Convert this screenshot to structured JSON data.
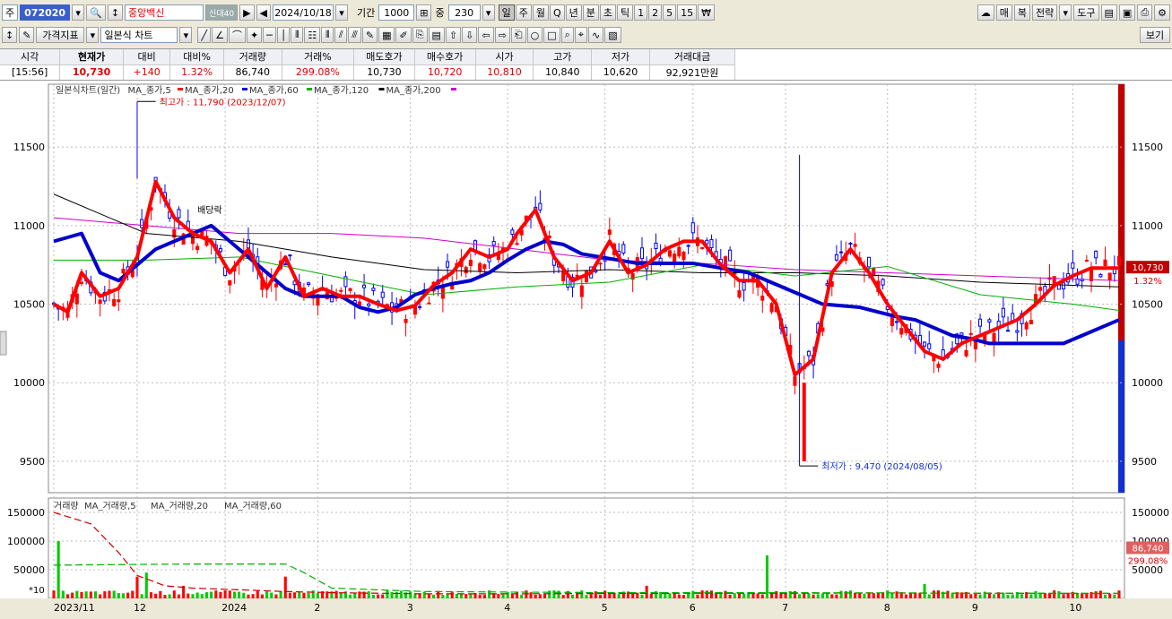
{
  "toolbar1": {
    "prefix": "주",
    "code": "072020",
    "name": "중앙백신",
    "badge": "신대40",
    "date": "2024/10/18",
    "period_label": "기간",
    "period_value": "1000",
    "count_label": "중",
    "count_value": "230",
    "intervals": [
      "일",
      "주",
      "월",
      "Q",
      "년",
      "분",
      "초",
      "틱",
      "1",
      "2",
      "5",
      "15",
      "₩"
    ],
    "right_buttons": [
      "매",
      "복",
      "전략",
      "도구"
    ]
  },
  "toolbar2": {
    "indicator_label": "가격지표",
    "chart_type": "일본식 차트",
    "view_label": "보기"
  },
  "quote": {
    "headers": [
      "시각",
      "현재가",
      "대비",
      "대비%",
      "거래량",
      "거래%",
      "매도호가",
      "매수호가",
      "시가",
      "고가",
      "저가",
      "거래대금"
    ],
    "values": [
      "[15:56]",
      "10,730",
      "+140",
      "1.32%",
      "86,740",
      "299.08%",
      "10,730",
      "10,720",
      "10,810",
      "10,840",
      "10,620",
      "92,921만원"
    ]
  },
  "price_legend": [
    "일본식차트(일간)",
    "MA_종가,5",
    "MA_종가,20",
    "MA_종가,60",
    "MA_종가,120",
    "MA_종가,200"
  ],
  "volume_legend": [
    "거래량",
    "MA_거래량,5",
    "MA_거래량,20",
    "MA_거래량,60"
  ],
  "annotations": {
    "high": "최고가 : 11,790 (2023/12/07)",
    "low": "최저가 : 9,470 (2024/08/05)",
    "dividend": "배당락",
    "volume_unit": "*10"
  },
  "right_labels": {
    "price": "10,730",
    "change": "1.32%",
    "volume": "86,740",
    "volume_pct": "299.08%"
  },
  "colors": {
    "ma5": "#ff0000",
    "ma20": "#0000cc",
    "ma60": "#00b000",
    "ma120": "#000000",
    "ma200": "#cc00cc",
    "up": "#ff0000",
    "down": "#0000ff"
  },
  "chart_data": [
    {
      "type": "line",
      "title": "일본식차트(일간)",
      "ylim": [
        9300,
        11900
      ],
      "y_ticks": [
        9500,
        10000,
        10500,
        11000,
        11500
      ],
      "x_labels": [
        "2023/11",
        "12",
        "2024",
        "2",
        "3",
        "4",
        "5",
        "6",
        "7",
        "8",
        "9",
        "10"
      ],
      "series": [
        {
          "name": "MA_종가,5",
          "x": [
            0,
            3,
            6,
            10,
            14,
            18,
            22,
            26,
            30,
            34,
            38,
            42,
            46,
            50,
            54,
            58,
            62,
            66,
            70,
            74,
            78,
            82,
            86,
            90,
            94,
            98,
            100,
            104,
            108,
            112,
            116,
            120,
            124,
            128,
            132,
            136,
            140,
            144,
            148,
            152,
            156,
            160,
            164,
            168,
            172,
            176,
            180,
            184,
            188,
            192,
            196,
            200,
            204,
            208,
            212,
            216,
            220,
            224,
            228,
            230
          ],
          "values": [
            10500,
            10450,
            10700,
            10550,
            10600,
            10800,
            11280,
            11050,
            10950,
            10900,
            10700,
            10850,
            10600,
            10800,
            10550,
            10600,
            10550,
            10550,
            10500,
            10460,
            10490,
            10620,
            10700,
            10850,
            10800,
            10850,
            10950,
            11100,
            10800,
            10650,
            10700,
            10900,
            10700,
            10750,
            10850,
            10900,
            10900,
            10750,
            10650,
            10650,
            10500,
            10050,
            10150,
            10700,
            10850,
            10700,
            10500,
            10350,
            10200,
            10150,
            10250,
            10300,
            10350,
            10400,
            10500,
            10620,
            10680,
            10730,
            10730,
            10730
          ]
        },
        {
          "name": "MA_종가,20",
          "x": [
            0,
            6,
            10,
            14,
            18,
            22,
            26,
            30,
            34,
            38,
            42,
            46,
            50,
            54,
            58,
            62,
            66,
            70,
            74,
            78,
            82,
            86,
            90,
            94,
            98,
            102,
            106,
            110,
            114,
            118,
            122,
            126,
            130,
            134,
            138,
            142,
            146,
            150,
            154,
            158,
            162,
            166,
            170,
            174,
            178,
            182,
            186,
            190,
            194,
            198,
            202,
            206,
            210,
            214,
            218,
            222,
            226,
            230
          ],
          "values": [
            10900,
            10950,
            10700,
            10650,
            10750,
            10850,
            10900,
            10950,
            11000,
            10900,
            10800,
            10700,
            10600,
            10550,
            10550,
            10550,
            10480,
            10450,
            10480,
            10560,
            10600,
            10630,
            10650,
            10700,
            10780,
            10850,
            10900,
            10880,
            10820,
            10800,
            10780,
            10760,
            10760,
            10760,
            10760,
            10740,
            10720,
            10700,
            10650,
            10600,
            10550,
            10500,
            10490,
            10480,
            10450,
            10420,
            10400,
            10350,
            10300,
            10280,
            10250,
            10250,
            10250,
            10250,
            10250,
            10300,
            10350,
            10400
          ]
        },
        {
          "name": "MA_종가,60",
          "x": [
            0,
            20,
            40,
            60,
            80,
            100,
            120,
            140,
            160,
            180,
            200,
            220,
            230
          ],
          "values": [
            10780,
            10780,
            10800,
            10680,
            10560,
            10610,
            10640,
            10750,
            10680,
            10740,
            10560,
            10500,
            10460
          ]
        },
        {
          "name": "MA_종가,120",
          "x": [
            0,
            20,
            40,
            60,
            80,
            100,
            120,
            140,
            160,
            180,
            200,
            220,
            230
          ],
          "values": [
            11200,
            10950,
            10900,
            10800,
            10720,
            10700,
            10720,
            10700,
            10700,
            10680,
            10640,
            10620,
            10610
          ]
        },
        {
          "name": "MA_종가,200",
          "x": [
            0,
            20,
            40,
            60,
            80,
            100,
            120,
            140,
            160,
            180,
            200,
            220,
            230
          ],
          "values": [
            11050,
            11000,
            10950,
            10950,
            10920,
            10850,
            10780,
            10760,
            10720,
            10700,
            10680,
            10660,
            10650
          ]
        }
      ]
    },
    {
      "type": "bar",
      "title": "거래량",
      "ylim": [
        0,
        175000
      ],
      "y_ticks": [
        50000,
        100000,
        150000
      ],
      "spikes": [
        {
          "x": 1,
          "value": 100000
        },
        {
          "x": 18,
          "value": 38000
        },
        {
          "x": 20,
          "value": 45000
        },
        {
          "x": 28,
          "value": 22000
        },
        {
          "x": 50,
          "value": 38000
        },
        {
          "x": 128,
          "value": 22000
        },
        {
          "x": 154,
          "value": 75000
        },
        {
          "x": 188,
          "value": 25000
        }
      ],
      "series": [
        {
          "name": "MA_거래량,20",
          "x": [
            0,
            8,
            14,
            18,
            24,
            30,
            40,
            50,
            60,
            70,
            80,
            100,
            120,
            140,
            160,
            180,
            200,
            220,
            230
          ],
          "values": [
            150000,
            130000,
            80000,
            40000,
            22000,
            18000,
            15000,
            12000,
            10000,
            9000,
            8000,
            8000,
            8500,
            9000,
            9000,
            9500,
            9000,
            8500,
            8500
          ]
        },
        {
          "name": "MA_거래량,60",
          "x": [
            0,
            30,
            50,
            54,
            60,
            80,
            120,
            160,
            200,
            230
          ],
          "values": [
            58000,
            60000,
            60000,
            45000,
            18000,
            12000,
            10000,
            10000,
            9000,
            9000
          ]
        }
      ]
    }
  ]
}
